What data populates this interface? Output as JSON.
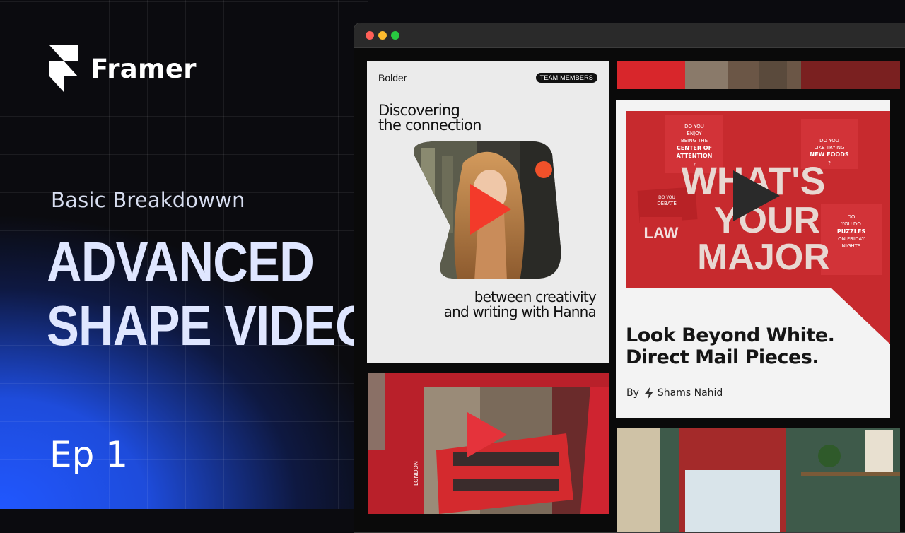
{
  "brand": {
    "name": "Framer"
  },
  "hero": {
    "subtitle": "Basic Breakdowwn",
    "headline_line1": "ADVANCED",
    "headline_line2": "SHAPE VIDEO",
    "episode": "Ep 1"
  },
  "colors": {
    "accent_blue": "#2157ff",
    "play_red": "#f33a2a",
    "dot_red": "#ff5f57",
    "dot_yellow": "#febc2e",
    "dot_green": "#28c840"
  },
  "browser": {
    "cards": {
      "bolder": {
        "brand": "Bolder",
        "tag": "TEAM MEMBERS",
        "heading_line1": "Discovering",
        "heading_line2": "the connection",
        "footer_line1": "between creativity",
        "footer_line2": "and writing with Hanna",
        "icon": "play-icon"
      },
      "mail": {
        "title_line1": "Look Beyond White.",
        "title_line2": "Direct Mail Pieces.",
        "by_label": "By",
        "author": "Shams Nahid",
        "poster_headline": "WHAT'S YOUR MAJOR",
        "poster_notes": [
          "DO YOU ENJOY BEING THE CENTER OF ATTENTION ?",
          "DO YOU LIKE TRYING NEW FOODS ?",
          "DO YOU DO PUZZLES ON FRIDAY NIGHTS ?",
          "DO YOU LOVE TO DEBATE WITH YOUR FRIENDS",
          "LAW"
        ],
        "icon": "play-icon"
      },
      "london": {
        "label": "LONDON",
        "icon": "play-icon"
      }
    }
  }
}
